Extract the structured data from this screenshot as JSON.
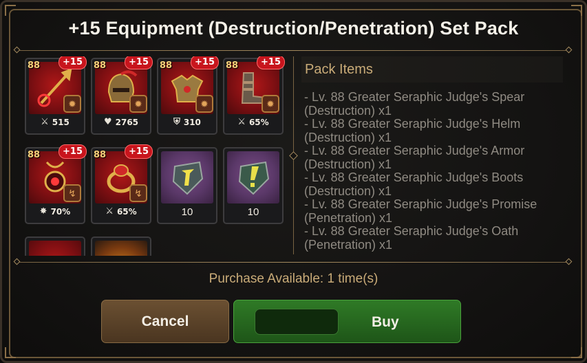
{
  "dialog": {
    "title": "+15 Equipment (Destruction/Penetration) Set Pack"
  },
  "items": [
    {
      "level": "88",
      "enhance": "+15",
      "stat_icon": "sword-icon",
      "stat": "515"
    },
    {
      "level": "88",
      "enhance": "+15",
      "stat_icon": "heart-icon",
      "stat": "2765"
    },
    {
      "level": "88",
      "enhance": "+15",
      "stat_icon": "shield-icon",
      "stat": "310"
    },
    {
      "level": "88",
      "enhance": "+15",
      "stat_icon": "sword-icon",
      "stat": "65%"
    },
    {
      "level": "88",
      "enhance": "+15",
      "stat_icon": "burst-icon",
      "stat": "70%"
    },
    {
      "level": "88",
      "enhance": "+15",
      "stat_icon": "sword-icon",
      "stat": "65%"
    },
    {
      "count": "10",
      "icon": "yellow-stone-icon"
    },
    {
      "count": "10",
      "icon": "green-stone-icon"
    }
  ],
  "pack": {
    "header": "Pack Items",
    "lines": [
      "- Lv. 88 Greater Seraphic Judge's Spear",
      "(Destruction) x1",
      "- Lv. 88 Greater Seraphic Judge's Helm",
      "(Destruction) x1",
      "- Lv. 88 Greater Seraphic Judge's Armor",
      "(Destruction) x1",
      "- Lv. 88 Greater Seraphic Judge's Boots",
      "(Destruction) x1",
      "- Lv. 88 Greater Seraphic Judge's Promise",
      "(Penetration) x1",
      "- Lv. 88 Greater Seraphic Judge's Oath",
      "(Penetration) x1"
    ]
  },
  "purchase_text": "Purchase Available: 1 time(s)",
  "buttons": {
    "cancel": "Cancel",
    "buy": "Buy"
  },
  "colors": {
    "accent_gold": "#c9ab78",
    "enhance_red": "#c8151d",
    "buy_green": "#2f7a26",
    "cancel_brown": "#6b5032"
  }
}
